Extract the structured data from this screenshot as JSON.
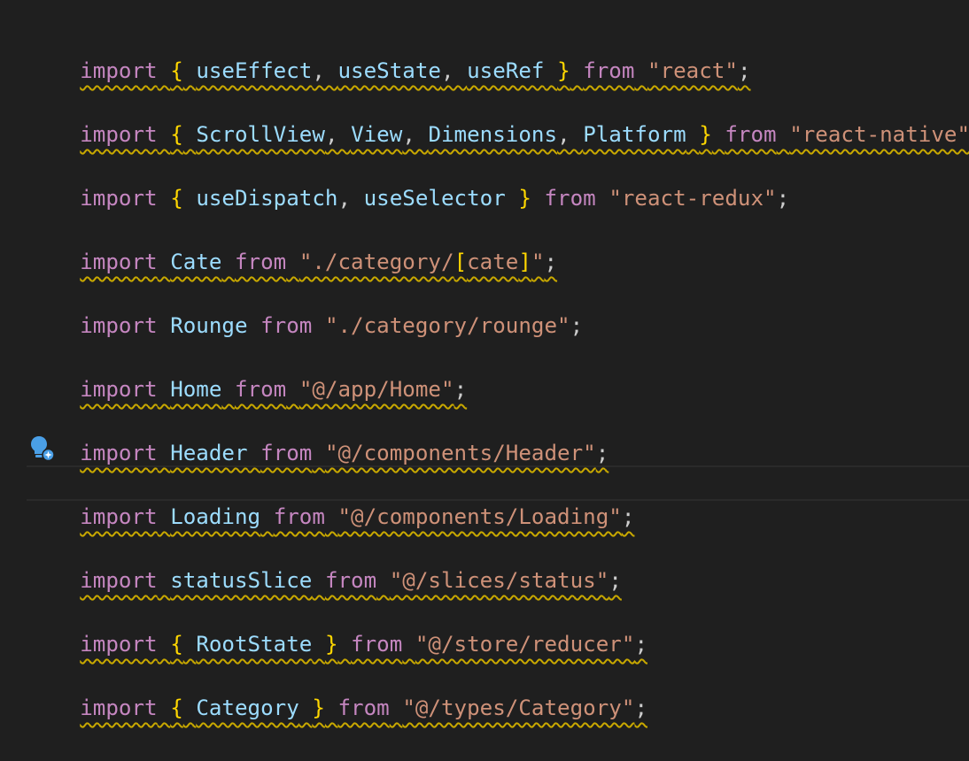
{
  "lines": [
    {
      "tokens": [
        "import",
        " ",
        "{",
        " ",
        "useEffect",
        ", ",
        "useState",
        ", ",
        "useRef",
        " ",
        "}",
        " ",
        "from",
        " ",
        "\"react\"",
        ";"
      ]
    },
    {
      "tokens": [
        "import",
        " ",
        "{",
        " ",
        "ScrollView",
        ", ",
        "View",
        ", ",
        "Dimensions",
        ", ",
        "Platform",
        " ",
        "}",
        " ",
        "from",
        " ",
        "\"react-native\"",
        ";"
      ]
    },
    {
      "tokens": [
        "import",
        " ",
        "{",
        " ",
        "useDispatch",
        ", ",
        "useSelector",
        " ",
        "}",
        " ",
        "from",
        " ",
        "\"react-redux\"",
        ";"
      ]
    },
    {
      "tokens": [
        "import",
        " ",
        "Cate",
        " ",
        "from",
        " ",
        "\"./category/",
        "[",
        "cate",
        "]",
        "\"",
        ";"
      ]
    },
    {
      "tokens": [
        "import",
        " ",
        "Rounge",
        " ",
        "from",
        " ",
        "\"./category/rounge\"",
        ";"
      ]
    },
    {
      "tokens": [
        "import",
        " ",
        "Home",
        " ",
        "from",
        " ",
        "\"@/app/Home\"",
        ";"
      ]
    },
    {
      "tokens": [
        "import",
        " ",
        "Header",
        " ",
        "from",
        " ",
        "\"@/components/Header\"",
        ";"
      ]
    },
    {
      "tokens": [
        "import",
        " ",
        "Loading",
        " ",
        "from",
        " ",
        "\"@/components/Loading\"",
        ";"
      ]
    },
    {
      "tokens": [
        "import",
        " ",
        "statusSlice",
        " ",
        "from",
        " ",
        "\"@/slices/status\"",
        ";"
      ]
    },
    {
      "tokens": [
        "import",
        " ",
        "{",
        " ",
        "RootState",
        " ",
        "}",
        " ",
        "from",
        " ",
        "\"@/store/reducer\"",
        ";"
      ]
    },
    {
      "tokens": [
        "import",
        " ",
        "{",
        " ",
        "Category",
        " ",
        "}",
        " ",
        "from",
        " ",
        "\"@/types/Category\"",
        ";"
      ]
    }
  ],
  "icons": {
    "code_action": "lightbulb-sparkle-icon"
  },
  "colors": {
    "background": "#1f1f1f",
    "keyword": "#c586c0",
    "identifier": "#9cdcfe",
    "string": "#ce9178",
    "bracket": "#ffd700",
    "squiggle": "#c8a800"
  }
}
